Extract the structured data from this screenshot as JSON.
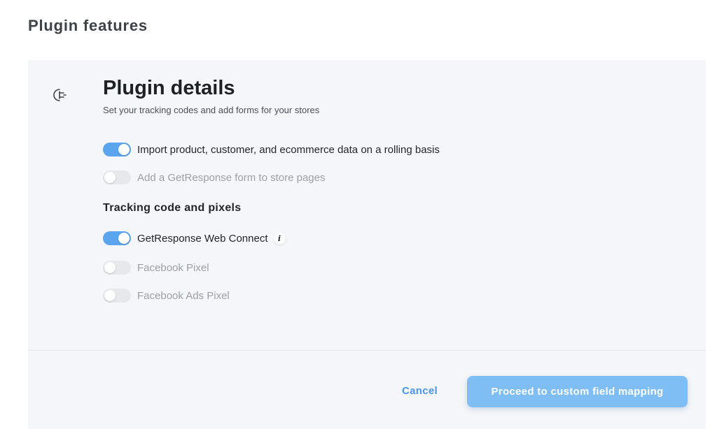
{
  "page": {
    "title": "Plugin features"
  },
  "colors": {
    "accent": "#5ba5ee",
    "toggle_off": "#e7e8eb",
    "button_bg": "#7fbef4",
    "link": "#4a96e6",
    "panel_bg": "#f5f6f9"
  },
  "details": {
    "icon": "plug-icon",
    "title": "Plugin details",
    "subtitle": "Set your tracking codes and add forms for your stores",
    "options": [
      {
        "label": "Import product, customer, and ecommerce data on a rolling basis",
        "enabled": true
      },
      {
        "label": "Add a GetResponse form to store pages",
        "enabled": false
      }
    ]
  },
  "tracking": {
    "heading": "Tracking code and pixels",
    "options": [
      {
        "label": "GetResponse Web Connect",
        "enabled": true,
        "info_icon": "i"
      },
      {
        "label": "Facebook Pixel",
        "enabled": false
      },
      {
        "label": "Facebook Ads Pixel",
        "enabled": false
      }
    ]
  },
  "footer": {
    "cancel_label": "Cancel",
    "proceed_label": "Proceed to custom field mapping"
  }
}
